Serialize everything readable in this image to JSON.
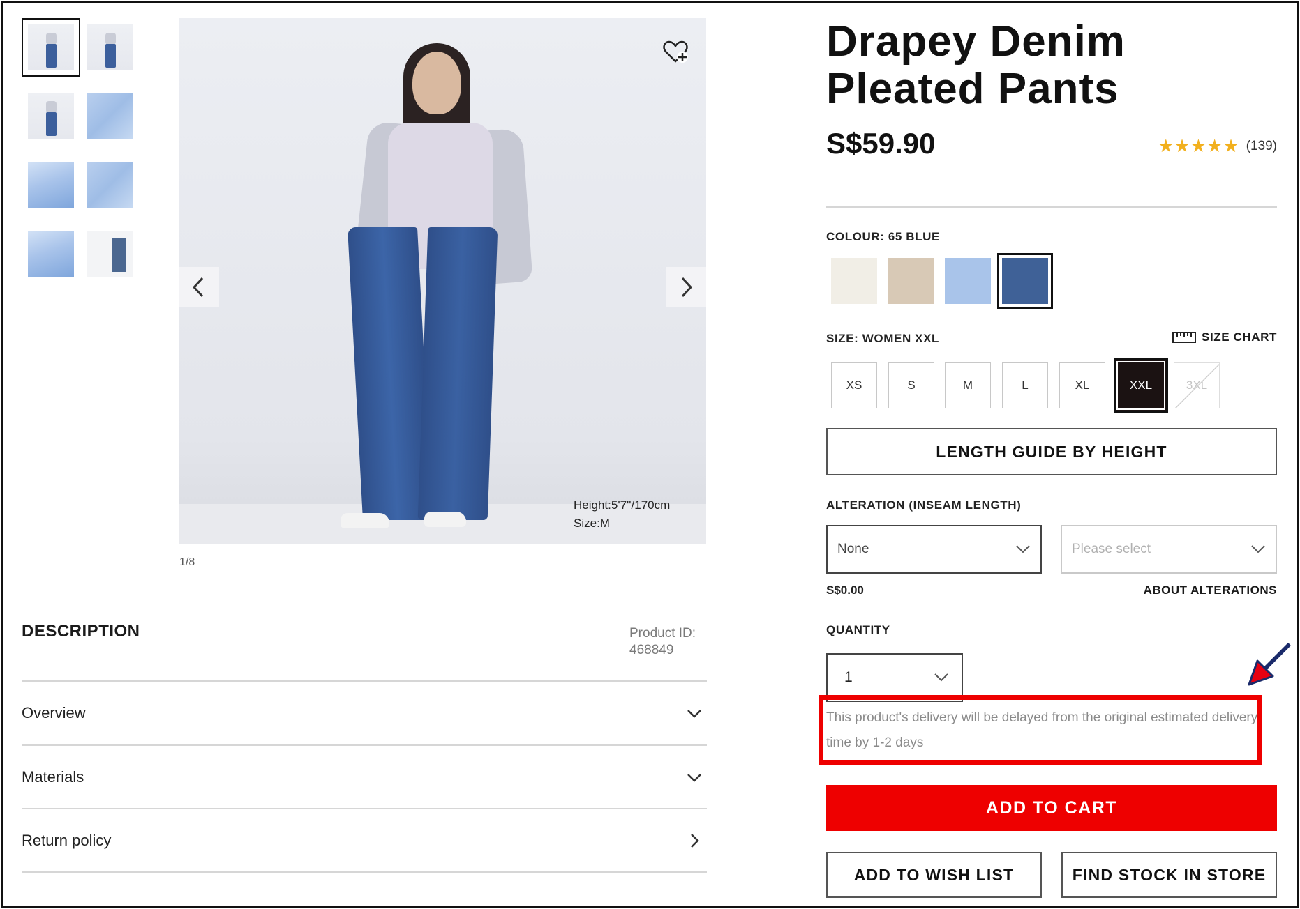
{
  "gallery": {
    "counter": "1/8",
    "caption_height": "Height:5'7''/170cm",
    "caption_size": "Size:M",
    "thumbnails": [
      "model-front",
      "model-side",
      "model-back",
      "flat-front",
      "flat-waist",
      "fabric-detail",
      "fabric-fold",
      "size-info"
    ]
  },
  "description": {
    "title": "DESCRIPTION",
    "product_id_label": "Product ID:",
    "product_id": "468849",
    "sections": [
      "Overview",
      "Materials",
      "Return policy"
    ]
  },
  "product": {
    "title": "Drapey Denim Pleated Pants",
    "price": "S$59.90",
    "stars": "★★★★★",
    "rating_value": 4.5,
    "review_count": "(139)"
  },
  "colour": {
    "label": "COLOUR: 65 BLUE",
    "swatches": [
      {
        "name": "off-white",
        "hex": "#f1eee6"
      },
      {
        "name": "beige",
        "hex": "#d8c9b6"
      },
      {
        "name": "light-blue",
        "hex": "#a9c4ea"
      },
      {
        "name": "blue",
        "hex": "#3f6197"
      }
    ],
    "selected_index": 3
  },
  "size": {
    "label": "SIZE: WOMEN XXL",
    "size_chart": "SIZE CHART",
    "options": [
      "XS",
      "S",
      "M",
      "L",
      "XL",
      "XXL",
      "3XL"
    ],
    "selected": "XXL",
    "unavailable": [
      "3XL"
    ]
  },
  "length_guide": "LENGTH GUIDE BY HEIGHT",
  "alteration": {
    "label": "ALTERATION (INSEAM LENGTH)",
    "type_value": "None",
    "length_placeholder": "Please select",
    "price": "S$0.00",
    "about": "ABOUT ALTERATIONS"
  },
  "quantity": {
    "label": "QUANTITY",
    "value": "1"
  },
  "notice": "This product's delivery will be delayed from the original estimated delivery time by 1-2 days",
  "actions": {
    "add_to_cart": "ADD TO CART",
    "add_to_wish_list": "ADD TO WISH LIST",
    "find_stock": "FIND STOCK IN STORE"
  },
  "colors": {
    "accent_red": "#ee0000",
    "star_gold": "#f2b01e",
    "annotation_arrow": "#e60012"
  }
}
